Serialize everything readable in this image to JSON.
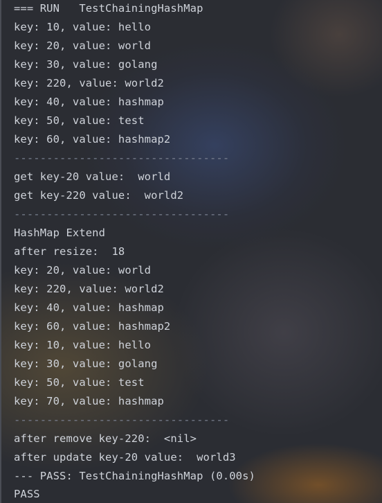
{
  "console": {
    "lines": [
      "=== RUN   TestChainingHashMap",
      "key: 10, value: hello",
      "key: 20, value: world",
      "key: 30, value: golang",
      "key: 220, value: world2",
      "key: 40, value: hashmap",
      "key: 50, value: test",
      "key: 60, value: hashmap2",
      "---------------------------------",
      "get key-20 value:  world",
      "get key-220 value:  world2",
      "---------------------------------",
      "HashMap Extend",
      "after resize:  18",
      "key: 20, value: world",
      "key: 220, value: world2",
      "key: 40, value: hashmap",
      "key: 60, value: hashmap2",
      "key: 10, value: hello",
      "key: 30, value: golang",
      "key: 50, value: test",
      "key: 70, value: hashmap",
      "---------------------------------",
      "after remove key-220:  <nil>",
      "after update key-20 value:  world3",
      "--- PASS: TestChainingHashMap (0.00s)",
      "PASS"
    ]
  },
  "colors": {
    "background": "#2b2d33",
    "text": "#cfd3da",
    "separator": "#7a8090"
  }
}
